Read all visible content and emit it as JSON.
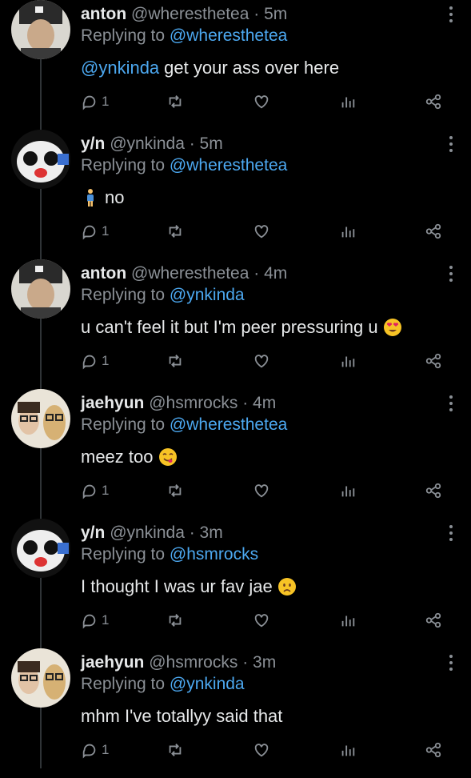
{
  "tweets": [
    {
      "name": "anton",
      "handle": "@wheresthetea",
      "time": "· 5m",
      "reply_prefix": "Replying to",
      "reply_to": "@wheresthetea",
      "text_mention": "@ynkinda",
      "text": "get your ass over here",
      "emoji": "",
      "lead_emoji": "",
      "replies": "1"
    },
    {
      "name": "y/n",
      "handle": "@ynkinda",
      "time": "· 5m",
      "reply_prefix": "Replying to",
      "reply_to": "@wheresthetea",
      "text_mention": "",
      "text": "no",
      "emoji": "",
      "lead_emoji": "person-standing",
      "replies": "1"
    },
    {
      "name": "anton",
      "handle": "@wheresthetea",
      "time": "· 4m",
      "reply_prefix": "Replying to",
      "reply_to": "@ynkinda",
      "text_mention": "",
      "text": "u can't feel it but I'm peer pressuring u",
      "emoji": "heart-eyes",
      "lead_emoji": "",
      "replies": "1"
    },
    {
      "name": "jaehyun",
      "handle": "@hsmrocks",
      "time": "· 4m",
      "reply_prefix": "Replying to",
      "reply_to": "@wheresthetea",
      "text_mention": "",
      "text": "meez too",
      "emoji": "yum",
      "lead_emoji": "",
      "replies": "1"
    },
    {
      "name": "y/n",
      "handle": "@ynkinda",
      "time": "· 3m",
      "reply_prefix": "Replying to",
      "reply_to": "@hsmrocks",
      "text_mention": "",
      "text": "I thought I was ur fav jae",
      "emoji": "frown",
      "lead_emoji": "",
      "replies": "1"
    },
    {
      "name": "jaehyun",
      "handle": "@hsmrocks",
      "time": "· 3m",
      "reply_prefix": "Replying to",
      "reply_to": "@ynkinda",
      "text_mention": "",
      "text": "mhm I've totallyy said that",
      "emoji": "",
      "lead_emoji": "",
      "replies": "1"
    }
  ],
  "colors": {
    "background": "#000000",
    "text": "#e7e9ea",
    "muted": "#8b9096",
    "link": "#4ca8f0"
  }
}
